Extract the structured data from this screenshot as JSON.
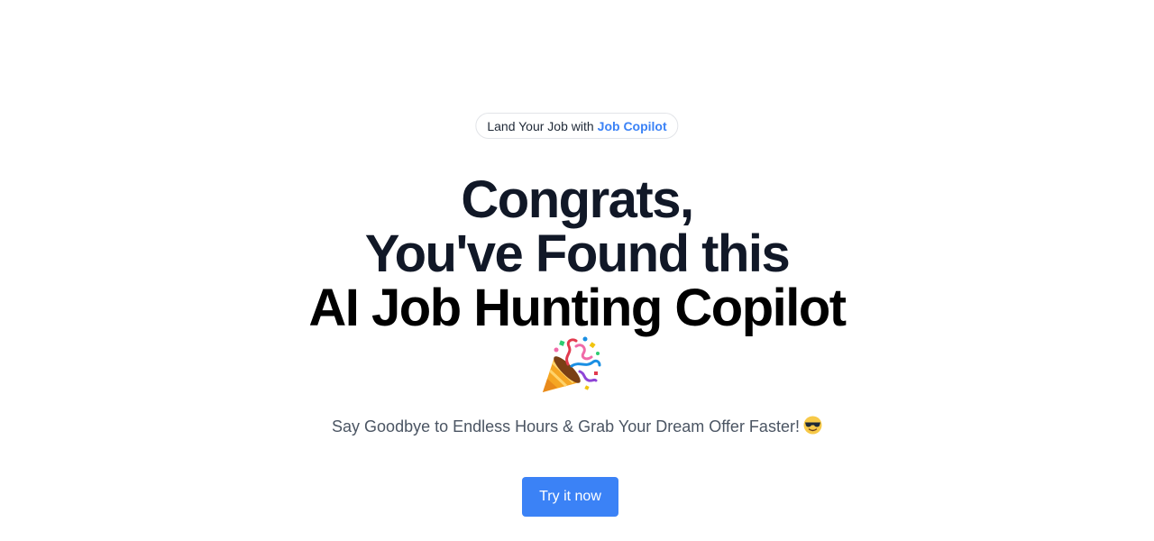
{
  "badge": {
    "lead_text": "Land Your Job with",
    "brand_text": "Job Copilot",
    "brand_color": "#3b82f6"
  },
  "headline": {
    "line1": "Congrats,",
    "line2": "You've Found this",
    "line3": "AI Job Hunting Copilot",
    "emoji_icon": "party-popper-icon"
  },
  "subtitle": {
    "text": "Say Goodbye to Endless Hours & Grab Your Dream Offer Faster!",
    "emoji_icon": "smiling-face-with-sunglasses-icon"
  },
  "cta": {
    "label": "Try it now",
    "color": "#3b82f6"
  }
}
